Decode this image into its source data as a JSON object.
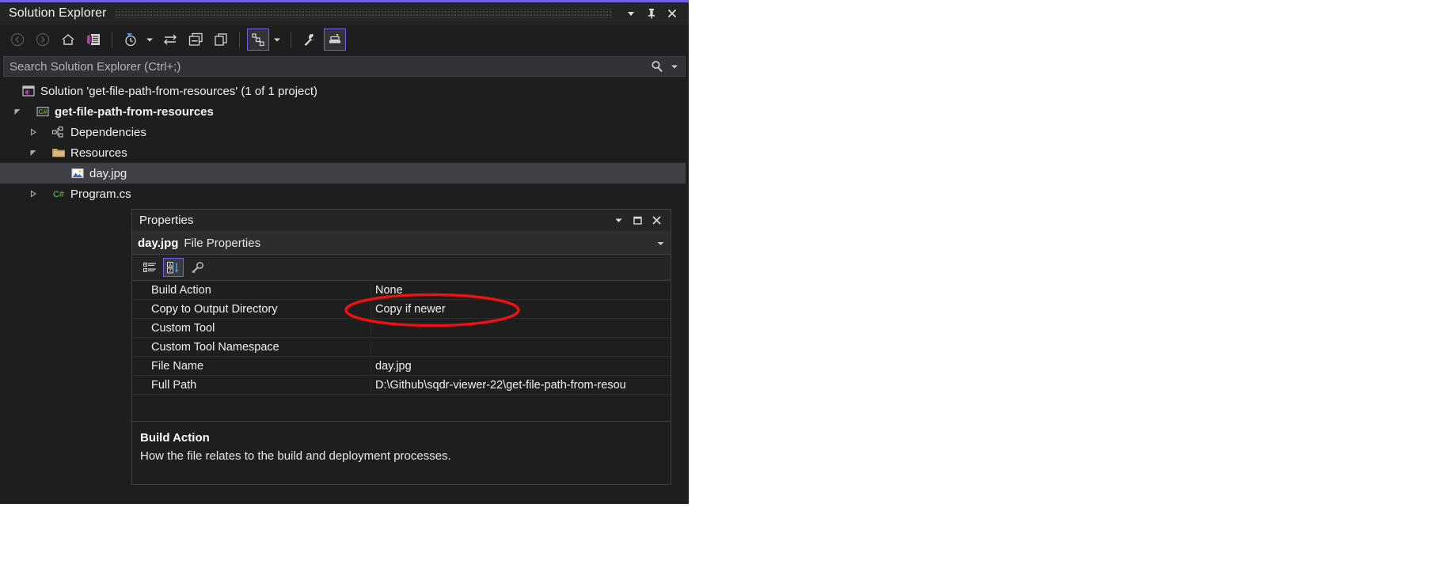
{
  "solution_explorer": {
    "title": "Solution Explorer",
    "window_buttons": [
      {
        "name": "dropdown-icon",
        "label": "▾"
      },
      {
        "name": "pin-icon",
        "label": "pin"
      },
      {
        "name": "close-icon",
        "label": "✕"
      }
    ],
    "toolbar": [
      {
        "name": "back-button",
        "icon": "back-arrow-icon",
        "active": false,
        "disabled": true
      },
      {
        "name": "forward-button",
        "icon": "forward-arrow-icon",
        "active": false,
        "disabled": true
      },
      {
        "name": "home-button",
        "icon": "home-icon",
        "active": false,
        "disabled": false
      },
      {
        "name": "solution-explorer-view-button",
        "icon": "vs-document-icon",
        "active": false,
        "disabled": false
      },
      {
        "name": "pending-changes-filter-button",
        "icon": "clock-filter-icon",
        "active": false,
        "disabled": false
      },
      {
        "name": "sync-with-active-document-button",
        "icon": "sync-arrows-icon",
        "active": false,
        "disabled": false
      },
      {
        "name": "collapse-all-button",
        "icon": "collapse-all-icon",
        "active": false,
        "disabled": false
      },
      {
        "name": "new-solution-explorer-view-button",
        "icon": "new-view-icon",
        "active": false,
        "disabled": false
      },
      {
        "name": "show-all-files-button",
        "icon": "show-all-files-icon",
        "active": true,
        "disabled": false
      },
      {
        "name": "properties-button",
        "icon": "wrench-icon",
        "active": false,
        "disabled": false
      },
      {
        "name": "preview-selected-items-button",
        "icon": "preview-icon",
        "active": true,
        "disabled": false
      }
    ],
    "search": {
      "placeholder": "Search Solution Explorer (Ctrl+;)",
      "value": "",
      "icon": "search-icon",
      "dropdown_icon": "chevron-down-icon"
    },
    "tree": [
      {
        "label": "Solution 'get-file-path-from-resources' (1 of 1 project)",
        "icon": "solution-icon",
        "indent": 0,
        "expander": "none",
        "bold": false,
        "selected": false
      },
      {
        "label": "get-file-path-from-resources",
        "icon": "csharp-project-icon",
        "indent": 1,
        "expander": "expanded",
        "bold": true,
        "selected": false
      },
      {
        "label": "Dependencies",
        "icon": "dependencies-icon",
        "indent": 2,
        "expander": "collapsed",
        "bold": false,
        "selected": false
      },
      {
        "label": "Resources",
        "icon": "folder-icon",
        "indent": 2,
        "expander": "expanded",
        "bold": false,
        "selected": false
      },
      {
        "label": "day.jpg",
        "icon": "image-file-icon",
        "indent": 3,
        "expander": "none",
        "bold": false,
        "selected": true
      },
      {
        "label": "Program.cs",
        "icon": "csharp-file-icon",
        "indent": 2,
        "expander": "collapsed",
        "bold": false,
        "selected": false
      }
    ]
  },
  "properties": {
    "title": "Properties",
    "window_buttons": [
      {
        "name": "dropdown-icon",
        "label": "▾"
      },
      {
        "name": "maximize-icon",
        "label": "□"
      },
      {
        "name": "close-icon",
        "label": "✕"
      }
    ],
    "object_name": "day.jpg",
    "object_type": "File Properties",
    "object_dropdown_icon": "chevron-down-icon",
    "toolbar": [
      {
        "name": "categorized-view-button",
        "icon": "categorized-icon",
        "active": false
      },
      {
        "name": "alphabetical-sort-button",
        "icon": "sort-alpha-icon",
        "active": true
      },
      {
        "name": "property-pages-button",
        "icon": "key-icon",
        "active": false
      }
    ],
    "rows": [
      {
        "name": "Build Action",
        "value": "None"
      },
      {
        "name": "Copy to Output Directory",
        "value": "Copy if newer"
      },
      {
        "name": "Custom Tool",
        "value": ""
      },
      {
        "name": "Custom Tool Namespace",
        "value": ""
      },
      {
        "name": "File Name",
        "value": "day.jpg"
      },
      {
        "name": "Full Path",
        "value": "D:\\Github\\sqdr-viewer-22\\get-file-path-from-resou"
      }
    ],
    "description": {
      "title": "Build Action",
      "text": "How the file relates to the build and deployment processes."
    }
  },
  "annotation": {
    "type": "ellipse",
    "color": "#ee1111",
    "target": "Copy if newer"
  },
  "colors": {
    "accent": "#7160e8",
    "window_background": "#1e1e1e",
    "titlebar_background": "#252526",
    "selection": "#3f3f46",
    "text": "#f1f1f1",
    "annotation": "#ee1111"
  }
}
